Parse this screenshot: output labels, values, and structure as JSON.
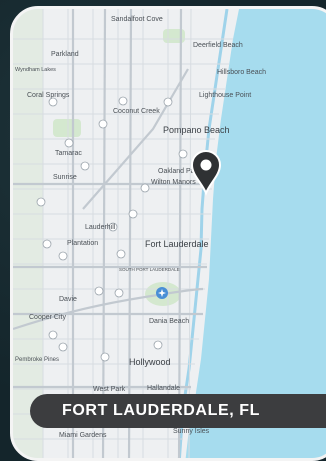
{
  "caption": "FORT LAUDERDALE, FL",
  "colors": {
    "ocean": "#a6dcee",
    "land": "#eef0f2",
    "road": "#c7cdd3",
    "water_inland": "#9fd3ea",
    "park": "#d4e8cf",
    "pin": "#2f3133",
    "caption_bg": "#3c3d3f",
    "frame": "#f4f4f4"
  },
  "map": {
    "places": {
      "sandalfoot_cove": "Sandalfoot Cove",
      "parkland": "Parkland",
      "deerfield_beach": "Deerfield Beach",
      "hillsboro_beach": "Hillsboro Beach",
      "lighthouse_point": "Lighthouse Point",
      "coral_springs": "Coral Springs",
      "coconut_creek": "Coconut Creek",
      "pompano_beach": "Pompano Beach",
      "tamarac": "Tamarac",
      "sunrise": "Sunrise",
      "oakland_park": "Oakland Park",
      "wilton_manors": "Wilton Manors",
      "lauderhill": "Lauderhill",
      "plantation": "Plantation",
      "fort_lauderdale": "Fort Lauderdale",
      "south_port_lauderdale": "SOUTH PORT LAUDERDALE",
      "davie": "Davie",
      "cooper_city": "Cooper City",
      "dania_beach": "Dania Beach",
      "pembroke_pines": "Pembroke Pines",
      "hollywood": "Hollywood",
      "west_park": "West Park",
      "hallandale": "Hallandale",
      "miami_gardens": "Miami Gardens",
      "sunny_isles": "Sunny Isles",
      "wyndham_lakes": "Wyndham Lakes"
    },
    "icons": {
      "location_pin": "map-pin-icon",
      "airport": "airport-icon"
    }
  }
}
